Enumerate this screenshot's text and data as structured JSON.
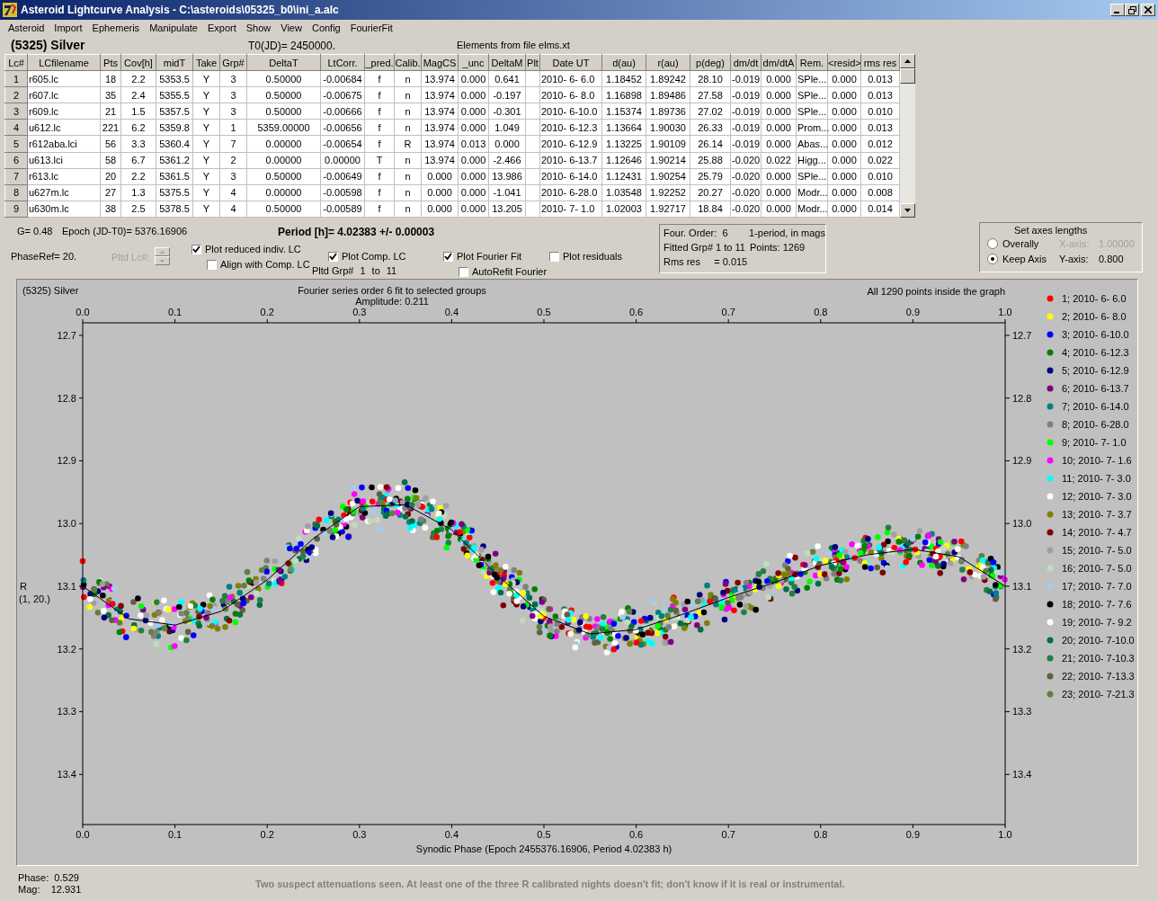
{
  "window": {
    "title": "Asteroid Lightcurve Analysis - C:\\asteroids\\05325_b0\\ini_a.alc"
  },
  "menu": [
    "Asteroid",
    "Import",
    "Ephemeris",
    "Manipulate",
    "Export",
    "Show",
    "View",
    "Config",
    "FourierFit"
  ],
  "header": {
    "asteroid": "(5325) Silver",
    "t0": "T0(JD)= 2450000.",
    "elements": "Elements from file elms.xt"
  },
  "table": {
    "columns": [
      "Lc#",
      "LCfilename",
      "Pts",
      "Cov[h]",
      "midT",
      "Take",
      "Grp#",
      "DeltaT",
      "LtCorr.",
      "_pred.",
      "Calib.",
      "MagCS",
      "_unc",
      "DeltaM",
      "Plt",
      "Date UT",
      "d(au)",
      "r(au)",
      "p(deg)",
      "dm/dt",
      "dm/dtA",
      "Rem.",
      "<resid>",
      "rms res"
    ],
    "rows": [
      {
        "cells": [
          "1",
          "r605.lc",
          "18",
          "2.2",
          "5353.5",
          "Y",
          "3",
          "0.50000",
          "-0.00684",
          "f",
          "n",
          "13.974",
          "0.000",
          "0.641",
          "",
          "2010- 6- 6.0",
          "1.18452",
          "1.89242",
          "28.10",
          "-0.019",
          "0.000",
          "SPle...",
          "0.000",
          "0.013"
        ]
      },
      {
        "cells": [
          "2",
          "r607.lc",
          "35",
          "2.4",
          "5355.5",
          "Y",
          "3",
          "0.50000",
          "-0.00675",
          "f",
          "n",
          "13.974",
          "0.000",
          "-0.197",
          "",
          "2010- 6- 8.0",
          "1.16898",
          "1.89486",
          "27.58",
          "-0.019",
          "0.000",
          "SPle...",
          "0.000",
          "0.013"
        ]
      },
      {
        "cells": [
          "3",
          "r609.lc",
          "21",
          "1.5",
          "5357.5",
          "Y",
          "3",
          "0.50000",
          "-0.00666",
          "f",
          "n",
          "13.974",
          "0.000",
          "-0.301",
          "",
          "2010- 6-10.0",
          "1.15374",
          "1.89736",
          "27.02",
          "-0.019",
          "0.000",
          "SPle...",
          "0.000",
          "0.010"
        ]
      },
      {
        "cells": [
          "4",
          "u612.lc",
          "221",
          "6.2",
          "5359.8",
          "Y",
          "1",
          "5359.00000",
          "-0.00656",
          "f",
          "n",
          "13.974",
          "0.000",
          "1.049",
          "",
          "2010- 6-12.3",
          "1.13664",
          "1.90030",
          "26.33",
          "-0.019",
          "0.000",
          "Prom...",
          "0.000",
          "0.013"
        ]
      },
      {
        "cells": [
          "5",
          "r612aba.lci",
          "56",
          "3.3",
          "5360.4",
          "Y",
          "7",
          "0.00000",
          "-0.00654",
          "f",
          "R",
          "13.974",
          "0.013",
          "0.000",
          "",
          "2010- 6-12.9",
          "1.13225",
          "1.90109",
          "26.14",
          "-0.019",
          "0.000",
          "Abas...",
          "0.000",
          "0.012"
        ]
      },
      {
        "cells": [
          "6",
          "u613.lci",
          "58",
          "6.7",
          "5361.2",
          "Y",
          "2",
          "0.00000",
          "0.00000",
          "T",
          "n",
          "13.974",
          "0.000",
          "-2.466",
          "",
          "2010- 6-13.7",
          "1.12646",
          "1.90214",
          "25.88",
          "-0.020",
          "0.022",
          "Higg...",
          "0.000",
          "0.022"
        ]
      },
      {
        "cells": [
          "7",
          "r613.lc",
          "20",
          "2.2",
          "5361.5",
          "Y",
          "3",
          "0.50000",
          "-0.00649",
          "f",
          "n",
          "0.000",
          "0.000",
          "13.986",
          "",
          "2010- 6-14.0",
          "1.12431",
          "1.90254",
          "25.79",
          "-0.020",
          "0.000",
          "SPle...",
          "0.000",
          "0.010"
        ]
      },
      {
        "cells": [
          "8",
          "u627m.lc",
          "27",
          "1.3",
          "5375.5",
          "Y",
          "4",
          "0.00000",
          "-0.00598",
          "f",
          "n",
          "0.000",
          "0.000",
          "-1.041",
          "",
          "2010- 6-28.0",
          "1.03548",
          "1.92252",
          "20.27",
          "-0.020",
          "0.000",
          "Modr...",
          "0.000",
          "0.008"
        ]
      },
      {
        "cells": [
          "9",
          "u630m.lc",
          "38",
          "2.5",
          "5378.5",
          "Y",
          "4",
          "0.50000",
          "-0.00589",
          "f",
          "n",
          "0.000",
          "0.000",
          "13.205",
          "",
          "2010- 7- 1.0",
          "1.02003",
          "1.92717",
          "18.84",
          "-0.020",
          "0.000",
          "Modr...",
          "0.000",
          "0.014"
        ]
      }
    ]
  },
  "controls": {
    "g": "G= 0.48",
    "epoch": "Epoch (JD-T0)= 5376.16906",
    "period": "Period [h]= 4.02383 +/- 0.00003",
    "phase_ref": "PhaseRef= 20.",
    "pltd_lc": {
      "label": "Pltd Lc#:",
      "disabled": true
    },
    "checkboxes": [
      {
        "label": "Plot reduced indiv. LC",
        "checked": true
      },
      {
        "label": "Align with Comp. LC",
        "checked": false
      },
      {
        "label": "Plot Comp. LC",
        "checked": true
      },
      {
        "label": "Plot Fourier Fit",
        "checked": true
      },
      {
        "label": "AutoRefit Fourier",
        "checked": false
      },
      {
        "label": "Plot residuals",
        "checked": false
      }
    ],
    "pltd_grp": [
      "Pltd Grp#",
      "1",
      "to",
      "11"
    ]
  },
  "fit_info": [
    [
      "Four. Order:  6",
      "1-period, in mags"
    ],
    [
      "Fitted Grp# 1 to 11",
      "Points: 1269"
    ],
    [
      "Rms res     = 0.015"
    ]
  ],
  "axes": {
    "title": "Set axes lengths",
    "options": [
      {
        "label": "Overally",
        "selected": false,
        "axis_label": "X-axis:",
        "axis_value": "1.00000",
        "disabled": true
      },
      {
        "label": "Keep Axis",
        "selected": true,
        "axis_label": "Y-axis:",
        "axis_value": "0.800",
        "disabled": false
      }
    ]
  },
  "plot": {
    "name": "(5325) Silver",
    "subtitle": "Amplitude: 0.211",
    "note": "All 1290 points inside the graph",
    "ylabel_sub": "(1, 20.)",
    "chart_data": {
      "type": "line",
      "title": "Fourier series order 6 fit to selected groups",
      "xlabel": "Synodic Phase (Epoch 2455376.16906, Period 4.02383 h)",
      "ylabel": "R",
      "x": [
        0,
        0.05,
        0.1,
        0.15,
        0.2,
        0.25,
        0.3,
        0.35,
        0.4,
        0.45,
        0.5,
        0.55,
        0.6,
        0.65,
        0.7,
        0.75,
        0.8,
        0.85,
        0.9,
        0.95,
        1
      ],
      "series": [
        {
          "color": "#000000",
          "values": [
            13.1,
            13.152,
            13.162,
            13.14,
            13.09,
            13.024,
            12.973,
            12.97,
            13.01,
            13.083,
            13.148,
            13.176,
            13.169,
            13.145,
            13.118,
            13.094,
            13.067,
            13.05,
            13.041,
            13.053,
            13.1
          ]
        }
      ],
      "xlim": [
        0,
        1
      ],
      "ylim": [
        13.48,
        12.68
      ],
      "xticks": [
        {
          "value": 0,
          "label": "0.0"
        },
        {
          "value": 0.1,
          "label": "0.1"
        },
        {
          "value": 0.2,
          "label": "0.2"
        },
        {
          "value": 0.3,
          "label": "0.3"
        },
        {
          "value": 0.4,
          "label": "0.4"
        },
        {
          "value": 0.5,
          "label": "0.5"
        },
        {
          "value": 0.6,
          "label": "0.6"
        },
        {
          "value": 0.7,
          "label": "0.7"
        },
        {
          "value": 0.8,
          "label": "0.8"
        },
        {
          "value": 0.9,
          "label": "0.9"
        },
        {
          "value": 1,
          "label": "1.0"
        }
      ],
      "yticks": [
        {
          "value": 12.7,
          "label": "12.7"
        },
        {
          "value": 12.8,
          "label": "12.8"
        },
        {
          "value": 12.9,
          "label": "12.9"
        },
        {
          "value": 13.0,
          "label": "13.0"
        },
        {
          "value": 13.1,
          "label": "13.1"
        },
        {
          "value": 13.2,
          "label": "13.2"
        },
        {
          "value": 13.3,
          "label": "13.3"
        },
        {
          "value": 13.4,
          "label": "13.4"
        }
      ]
    },
    "legend": [
      {
        "label": "1; 2010- 6- 6.0",
        "color": "#ff0000"
      },
      {
        "label": "2; 2010- 6- 8.0",
        "color": "#ffff00"
      },
      {
        "label": "3; 2010- 6-10.0",
        "color": "#0000ff"
      },
      {
        "label": "4; 2010- 6-12.3",
        "color": "#008000"
      },
      {
        "label": "5; 2010- 6-12.9",
        "color": "#000080"
      },
      {
        "label": "6; 2010- 6-13.7",
        "color": "#800080"
      },
      {
        "label": "7; 2010- 6-14.0",
        "color": "#008080"
      },
      {
        "label": "8; 2010- 6-28.0",
        "color": "#808080"
      },
      {
        "label": "9; 2010- 7- 1.0",
        "color": "#00ff00"
      },
      {
        "label": "10; 2010- 7- 1.6",
        "color": "#ff00ff"
      },
      {
        "label": "11; 2010- 7- 3.0",
        "color": "#00ffff"
      },
      {
        "label": "12; 2010- 7- 3.0",
        "color": "#ffffff"
      },
      {
        "label": "13; 2010- 7- 3.7",
        "color": "#808000"
      },
      {
        "label": "14; 2010- 7- 4.7",
        "color": "#800000"
      },
      {
        "label": "15; 2010- 7- 5.0",
        "color": "#a0a0a4"
      },
      {
        "label": "16; 2010- 7- 5.0",
        "color": "#c0dcc0"
      },
      {
        "label": "17; 2010- 7- 7.0",
        "color": "#a6caf0"
      },
      {
        "label": "18; 2010- 7- 7.6",
        "color": "#000000"
      },
      {
        "label": "19; 2010- 7- 9.2",
        "color": "#fffbf0"
      },
      {
        "label": "20; 2010- 7-10.0",
        "color": "#007040"
      },
      {
        "label": "21; 2010- 7-10.3",
        "color": "#208040"
      },
      {
        "label": "22; 2010- 7-13.3",
        "color": "#606040"
      },
      {
        "label": "23; 2010- 7-21.3",
        "color": "#608040"
      }
    ]
  },
  "status": {
    "phase": "Phase:  0.529",
    "mag": "Mag:    12.931",
    "message": "Two suspect attenuations seen. At least one of the three R calibrated nights doesn't fit; don't know if it is real or instrumental."
  }
}
